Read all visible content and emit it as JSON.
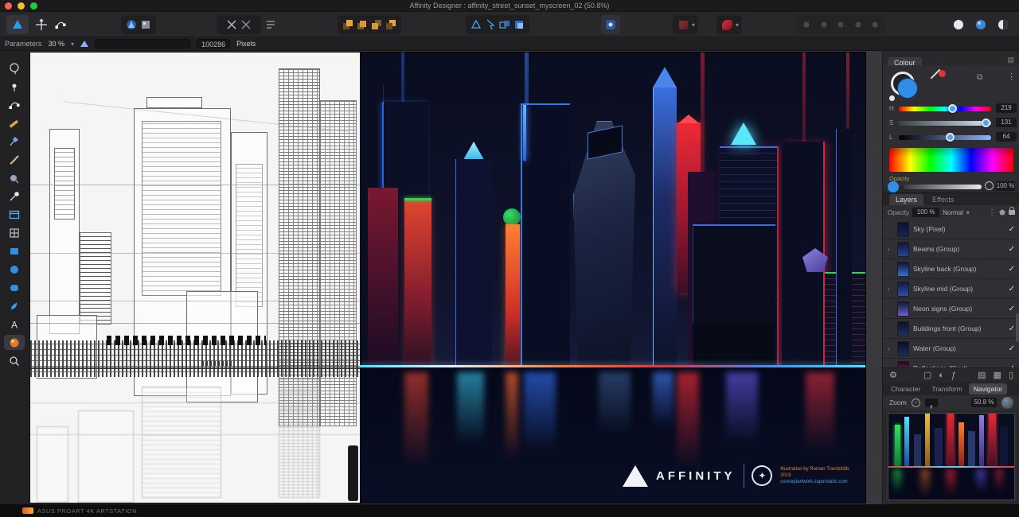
{
  "window": {
    "title": "Affinity Designer : affinity_street_sunset_myscreen_02 (50.8%)"
  },
  "context_bar": {
    "label": "Parameters",
    "value": "30 %",
    "field_value": "100286",
    "units": "Pixels"
  },
  "toolbar": {
    "left_icons": [
      "app-logo",
      "move-tool",
      "node-edit"
    ],
    "personas": [
      "designer-persona",
      "pixel-persona"
    ],
    "toggle_group": [
      "cut-a",
      "cut-b",
      "options-list"
    ],
    "arrange_icons": [
      "move-to-front",
      "move-forward",
      "move-backward",
      "move-to-back"
    ],
    "geometry_icons": [
      "insert-triangle",
      "insert-cursor",
      "insert-behind",
      "insert-inside"
    ],
    "snapping_icon": "snapping",
    "disabled_icons": [
      "align-left",
      "align-center",
      "align-right",
      "distribute-h",
      "distribute-v"
    ],
    "view_icons": [
      "preview-light",
      "preview-blue",
      "preview-split"
    ]
  },
  "tools": [
    {
      "name": "lasso-tool"
    },
    {
      "name": "pen-point-tool"
    },
    {
      "name": "node-tool"
    },
    {
      "name": "pencil-tool"
    },
    {
      "name": "vector-pen-tool"
    },
    {
      "name": "brush-tool"
    },
    {
      "name": "fill-tool"
    },
    {
      "name": "colour-picker-tool"
    },
    {
      "name": "artboard-tool"
    },
    {
      "name": "symbol-tool"
    },
    {
      "name": "rectangle-tool"
    },
    {
      "name": "ellipse-tool"
    },
    {
      "name": "rounded-rectangle-tool"
    },
    {
      "name": "vector-brush-tool"
    },
    {
      "name": "text-tool"
    },
    {
      "name": "transparency-tool",
      "selected": true
    },
    {
      "name": "zoom-tool"
    }
  ],
  "colour_panel": {
    "tab": "Colour",
    "sliders": [
      {
        "label": "H",
        "value": "219"
      },
      {
        "label": "S",
        "value": "131"
      },
      {
        "label": "L",
        "value": "64"
      }
    ],
    "opacity_label": "Opacity",
    "opacity_value": "100 %",
    "accent": "#2f8fe8"
  },
  "layers_panel": {
    "tab_layers": "Layers",
    "tab_effects": "Effects",
    "opacity_label": "Opacity",
    "opacity_value": "100 %",
    "blend_mode": "Normal",
    "rows": [
      {
        "name": "Sky (Pixel)",
        "expand": false,
        "thumb": [
          "#0d1130",
          "#1a2250"
        ],
        "visible": true
      },
      {
        "name": "Beams (Group)",
        "expand": true,
        "thumb": [
          "#101638",
          "#24439a"
        ],
        "visible": true
      },
      {
        "name": "Skyline back (Group)",
        "expand": false,
        "thumb": [
          "#0e1433",
          "#3a6fd8"
        ],
        "visible": true
      },
      {
        "name": "Skyline mid (Group)",
        "expand": true,
        "thumb": [
          "#111a40",
          "#2a4fb0"
        ],
        "visible": true
      },
      {
        "name": "Neon signs (Group)",
        "expand": false,
        "thumb": [
          "#131a3a",
          "#6a5fd0"
        ],
        "visible": true
      },
      {
        "name": "Buildings front (Group)",
        "expand": false,
        "thumb": [
          "#0c1028",
          "#23305e"
        ],
        "visible": true
      },
      {
        "name": "Water (Group)",
        "expand": true,
        "thumb": [
          "#0a0e24",
          "#173058"
        ],
        "visible": true
      },
      {
        "name": "Reflections (Pixel)",
        "expand": true,
        "thumb": [
          "#140c28",
          "#c03050"
        ],
        "visible": true
      }
    ]
  },
  "bottom_tabs": {
    "a": "Character",
    "b": "Transform",
    "c": "Navigator"
  },
  "navigator": {
    "zoom_label": "Zoom",
    "zoom_value": "50.8 %"
  },
  "status_bar": {
    "text": "ASUS PROART 4K ARTSTATION"
  },
  "artwork": {
    "brand": "AFFINITY",
    "credit_line1": "Illustration by Roman Tverdohlib, 2019",
    "credit_line2": "conceptartwork.superstatic.com"
  },
  "colors": {
    "accent_blue": "#2f8fe8",
    "neon_cyan": "#4fe3ff",
    "neon_red": "#e8333a",
    "neon_green": "#2ad94c",
    "neon_orange": "#ff7a30",
    "sky": "#0e1128"
  }
}
